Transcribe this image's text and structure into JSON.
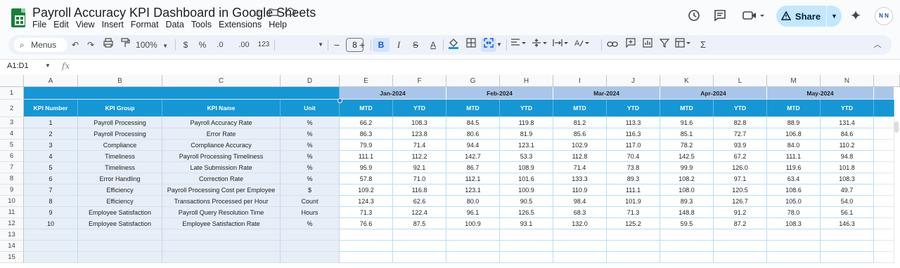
{
  "title": "Payroll Accuracy KPI Dashboard in Google Sheets",
  "menu": [
    "File",
    "Edit",
    "View",
    "Insert",
    "Format",
    "Data",
    "Tools",
    "Extensions",
    "Help"
  ],
  "share_label": "Share",
  "avatar_text": "N N",
  "toolbar": {
    "menus_label": "Menus",
    "zoom": "100%",
    "currency": "$",
    "percent": "%",
    "dec_decrease": ".0",
    "dec_increase": ".00",
    "number_format": "123",
    "font_size": "8",
    "bold": "B",
    "italic": "I",
    "strike": "S",
    "text_color": "A",
    "minus": "−",
    "plus": "+",
    "sigma": "Σ"
  },
  "name_box": "A1:D1",
  "fx": "fx",
  "columns": [
    "A",
    "B",
    "C",
    "D",
    "E",
    "F",
    "G",
    "H",
    "I",
    "J",
    "K",
    "L",
    "M",
    "N"
  ],
  "row_numbers": [
    "1",
    "2",
    "3",
    "4",
    "5",
    "6",
    "7",
    "8",
    "9",
    "10",
    "11",
    "12",
    "13",
    "14",
    "15"
  ],
  "headers": {
    "kpi_number": "KPI Number",
    "kpi_group": "KPI Group",
    "kpi_name": "KPI Name",
    "unit": "Unit",
    "months": [
      "Jan-2024",
      "Feb-2024",
      "Mar-2024",
      "Apr-2024",
      "May-2024"
    ],
    "mtd": "MTD",
    "ytd": "YTD"
  },
  "rows": [
    {
      "num": "1",
      "group": "Payroll Processing",
      "name": "Payroll Accuracy Rate",
      "unit": "%",
      "vals": [
        "66.2",
        "108.3",
        "84.5",
        "119.8",
        "81.2",
        "113.3",
        "91.6",
        "82.8",
        "88.9",
        "131.4"
      ]
    },
    {
      "num": "2",
      "group": "Payroll Processing",
      "name": "Error Rate",
      "unit": "%",
      "vals": [
        "86.3",
        "123.8",
        "80.6",
        "81.9",
        "85.6",
        "116.3",
        "85.1",
        "72.7",
        "106.8",
        "84.6"
      ]
    },
    {
      "num": "3",
      "group": "Compliance",
      "name": "Compliance Accuracy",
      "unit": "%",
      "vals": [
        "79.9",
        "71.4",
        "94.4",
        "123.1",
        "102.9",
        "117.0",
        "78.2",
        "93.9",
        "84.0",
        "110.2"
      ]
    },
    {
      "num": "4",
      "group": "Timeliness",
      "name": "Payroll Processing Timeliness",
      "unit": "%",
      "vals": [
        "111.1",
        "112.2",
        "142.7",
        "53.3",
        "112.8",
        "70.4",
        "142.5",
        "67.2",
        "111.1",
        "94.8"
      ]
    },
    {
      "num": "5",
      "group": "Timeliness",
      "name": "Late Submission Rate",
      "unit": "%",
      "vals": [
        "95.9",
        "92.1",
        "86.7",
        "108.9",
        "71.4",
        "73.8",
        "99.9",
        "126.0",
        "119.6",
        "101.8"
      ]
    },
    {
      "num": "6",
      "group": "Error Handling",
      "name": "Correction Rate",
      "unit": "%",
      "vals": [
        "57.8",
        "71.0",
        "112.1",
        "101.6",
        "133.3",
        "89.3",
        "108.2",
        "97.1",
        "63.4",
        "108.3"
      ]
    },
    {
      "num": "7",
      "group": "Efficiency",
      "name": "Payroll Processing Cost per Employee",
      "unit": "$",
      "vals": [
        "109.2",
        "116.8",
        "123.1",
        "100.9",
        "110.9",
        "111.1",
        "108.0",
        "120.5",
        "108.6",
        "49.7"
      ]
    },
    {
      "num": "8",
      "group": "Efficiency",
      "name": "Transactions Processed per Hour",
      "unit": "Count",
      "vals": [
        "124.3",
        "62.6",
        "80.0",
        "90.5",
        "98.4",
        "101.9",
        "89.3",
        "126.7",
        "105.0",
        "54.0"
      ]
    },
    {
      "num": "9",
      "group": "Employee Satisfaction",
      "name": "Payroll Query Resolution Time",
      "unit": "Hours",
      "vals": [
        "71.3",
        "122.4",
        "96.1",
        "126.5",
        "68.3",
        "71.3",
        "148.8",
        "91.2",
        "78.0",
        "56.1"
      ]
    },
    {
      "num": "10",
      "group": "Employee Satisfaction",
      "name": "Employee Satisfaction Rate",
      "unit": "%",
      "vals": [
        "76.6",
        "87.5",
        "100.9",
        "93.1",
        "132.0",
        "125.2",
        "59.5",
        "87.2",
        "108.3",
        "146.3"
      ]
    }
  ],
  "colors": {
    "header_blue": "#1597d5",
    "month_band": "#a9c6ea",
    "info_fill": "#e6eef7",
    "share_bg": "#c2e7ff",
    "sheets_green": "#188038"
  }
}
